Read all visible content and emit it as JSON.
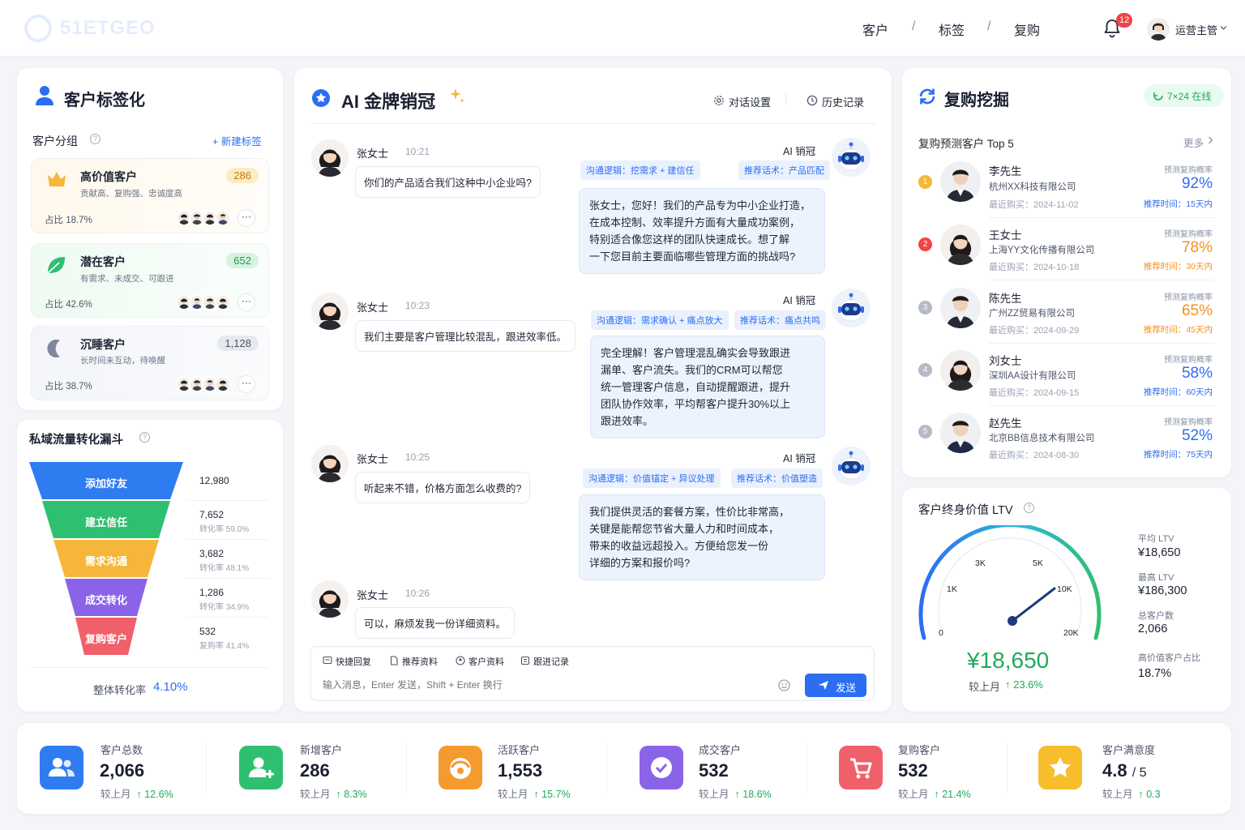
{
  "header": {
    "logo_text": "51ETGEO",
    "nav": [
      "客户",
      "标签",
      "复购"
    ],
    "nav_sep": "/",
    "notification_count": "12",
    "user_role": "运营主管"
  },
  "segments": {
    "title": "客户标签化",
    "group_label": "客户分组",
    "new_tag": "+ 新建标签",
    "items": [
      {
        "name": "高价值客户",
        "desc": "贡献高、复购强、忠诚度高",
        "count": "286",
        "share": "占比 18.7%"
      },
      {
        "name": "潜在客户",
        "desc": "有需求、未成交、可跟进",
        "count": "652",
        "share": "占比 42.6%"
      },
      {
        "name": "沉睡客户",
        "desc": "长时间未互动，待唤醒",
        "count": "1,128",
        "share": "占比 38.7%"
      }
    ]
  },
  "funnel": {
    "title": "私域流量转化漏斗",
    "stages": [
      {
        "name": "添加好友",
        "value": "12,980",
        "rate": "",
        "fraction": 1.0,
        "color": "#2f7cf1"
      },
      {
        "name": "建立信任",
        "value": "7,652",
        "rate": "转化率 59.0%",
        "fraction": 0.59,
        "color": "#2fbf71"
      },
      {
        "name": "需求沟通",
        "value": "3,682",
        "rate": "转化率 48.1%",
        "fraction": 0.481,
        "color": "#f5b63a"
      },
      {
        "name": "成交转化",
        "value": "1,286",
        "rate": "转化率 34.9%",
        "fraction": 0.349,
        "color": "#8b63e8"
      },
      {
        "name": "复购客户",
        "value": "532",
        "rate": "复购率 41.4%",
        "fraction": 0.414,
        "color": "#f0606a"
      }
    ],
    "overall_label": "整体转化率",
    "overall_value": "4.10%"
  },
  "chat": {
    "title": "AI 金牌销冠",
    "settings": "对话设置",
    "history": "历史记录",
    "ai_name": "AI 销冠",
    "messages": [
      {
        "user": "张女士",
        "time": "10:21",
        "text": "你们的产品适合我们这种中小企业吗?",
        "tag1": "沟通逻辑：挖需求 + 建信任",
        "tag2": "推荐话术：产品匹配",
        "reply": [
          "张女士，您好！我们的产品专为中小企业打造，",
          "在成本控制、效率提升方面有大量成功案例，",
          "特别适合像您这样的团队快速成长。想了解",
          "一下您目前主要面临哪些管理方面的挑战吗?"
        ]
      },
      {
        "user": "张女士",
        "time": "10:23",
        "text": "我们主要是客户管理比较混乱，跟进效率低。",
        "tag1": "沟通逻辑：需求确认 + 痛点放大",
        "tag2": "推荐话术：痛点共鸣",
        "reply": [
          "完全理解！客户管理混乱确实会导致跟进",
          "漏单、客户流失。我们的CRM可以帮您",
          "统一管理客户信息，自动提醒跟进，提升",
          "团队协作效率，平均帮客户提升30%以上",
          "跟进效率。"
        ]
      },
      {
        "user": "张女士",
        "time": "10:25",
        "text": "听起来不错，价格方面怎么收费的?",
        "tag1": "沟通逻辑：价值锚定 + 异议处理",
        "tag2": "推荐话术：价值塑造",
        "reply": [
          "我们提供灵活的套餐方案，性价比非常高，",
          "关键是能帮您节省大量人力和时间成本，",
          "带来的收益远超投入。方便给您发一份",
          "详细的方案和报价吗?"
        ]
      },
      {
        "user": "张女士",
        "time": "10:26",
        "text": "可以，麻烦发我一份详细资料。"
      }
    ],
    "tools": [
      "快捷回复",
      "推荐资料",
      "客户资料",
      "跟进记录"
    ],
    "input_placeholder": "输入消息，Enter 发送，Shift + Enter 换行",
    "send": "发送"
  },
  "repurchase": {
    "title": "复购挖掘",
    "online": "7×24 在线",
    "list_title": "复购预测客户 Top 5",
    "more": "更多",
    "prob_label": "预测复购概率",
    "date_prefix": "最近购买：",
    "rec_prefix": "推荐时间：",
    "customers": [
      {
        "rank": "1",
        "name": "李先生",
        "company": "杭州XX科技有限公司",
        "date": "2024-11-02",
        "prob": "92%",
        "rec": "15天内",
        "color": "#2c6ef2",
        "rank_color": "#f5b63a"
      },
      {
        "rank": "2",
        "name": "王女士",
        "company": "上海YY文化传播有限公司",
        "date": "2024-10-18",
        "prob": "78%",
        "rec": "30天内",
        "color": "#f5901e",
        "rank_color": "#f04444"
      },
      {
        "rank": "3",
        "name": "陈先生",
        "company": "广州ZZ贸易有限公司",
        "date": "2024-09-29",
        "prob": "65%",
        "rec": "45天内",
        "color": "#f5901e",
        "rank_color": "#b4bac6"
      },
      {
        "rank": "4",
        "name": "刘女士",
        "company": "深圳AA设计有限公司",
        "date": "2024-09-15",
        "prob": "58%",
        "rec": "60天内",
        "color": "#2c6ef2",
        "rank_color": "#b4bac6"
      },
      {
        "rank": "5",
        "name": "赵先生",
        "company": "北京BB信息技术有限公司",
        "date": "2024-08-30",
        "prob": "52%",
        "rec": "75天内",
        "color": "#2c6ef2",
        "rank_color": "#b4bac6"
      }
    ]
  },
  "ltv": {
    "title": "客户终身价值 LTV",
    "gauge_ticks": [
      "0",
      "1K",
      "3K",
      "5K",
      "10K",
      "20K"
    ],
    "gauge_value": 18650,
    "value": "¥18,650",
    "compare_label": "较上月",
    "compare_value": "↑ 23.6%",
    "stats": [
      {
        "label": "平均 LTV",
        "value": "¥18,650"
      },
      {
        "label": "最高 LTV",
        "value": "¥186,300"
      },
      {
        "label": "总客户数",
        "value": "2,066"
      },
      {
        "label": "高价值客户占比",
        "value": "18.7%"
      }
    ]
  },
  "stats": [
    {
      "label": "客户总数",
      "value": "2,066",
      "cmp_label": "较上月",
      "cmp": "↑ 12.6%",
      "color": "#2f7cf1"
    },
    {
      "label": "新增客户",
      "value": "286",
      "cmp_label": "较上月",
      "cmp": "↑ 8.3%",
      "color": "#2fbf71"
    },
    {
      "label": "活跃客户",
      "value": "1,553",
      "cmp_label": "较上月",
      "cmp": "↑ 15.7%",
      "color": "#f59a2f"
    },
    {
      "label": "成交客户",
      "value": "532",
      "cmp_label": "较上月",
      "cmp": "↑ 18.6%",
      "color": "#8b63e8"
    },
    {
      "label": "复购客户",
      "value": "532",
      "cmp_label": "较上月",
      "cmp": "↑ 21.4%",
      "color": "#f0606a"
    },
    {
      "label": "客户满意度",
      "value": "4.8",
      "value_suffix": "/ 5",
      "cmp_label": "较上月",
      "cmp": "↑ 0.3",
      "color": "#f7bd2c"
    }
  ]
}
